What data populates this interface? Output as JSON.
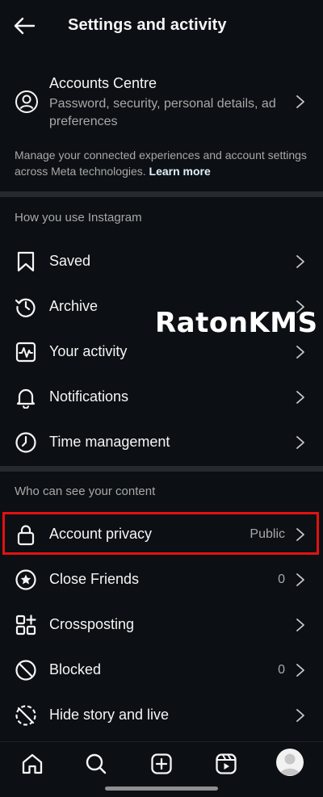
{
  "header": {
    "title": "Settings and activity"
  },
  "accounts_centre": {
    "title": "Accounts Centre",
    "description": "Password, security, personal details, ad preferences"
  },
  "meta_note": {
    "text": "Manage your connected experiences and account settings across Meta technologies.",
    "link": "Learn more"
  },
  "section_usage": {
    "header": "How you use Instagram",
    "items": [
      {
        "label": "Saved",
        "icon": "bookmark-icon"
      },
      {
        "label": "Archive",
        "icon": "archive-icon"
      },
      {
        "label": "Your activity",
        "icon": "activity-icon"
      },
      {
        "label": "Notifications",
        "icon": "bell-icon"
      },
      {
        "label": "Time management",
        "icon": "clock-icon"
      }
    ]
  },
  "section_content": {
    "header": "Who can see your content",
    "items": [
      {
        "label": "Account privacy",
        "value": "Public",
        "icon": "lock-icon",
        "highlighted": true
      },
      {
        "label": "Close Friends",
        "value": "0",
        "icon": "star-circle-icon"
      },
      {
        "label": "Crossposting",
        "value": "",
        "icon": "crossposting-icon"
      },
      {
        "label": "Blocked",
        "value": "0",
        "icon": "blocked-icon"
      },
      {
        "label": "Hide story and live",
        "value": "",
        "icon": "hide-story-icon"
      }
    ]
  },
  "watermark": "RatonKMS",
  "bottom_nav": [
    "home-icon",
    "search-icon",
    "new-post-icon",
    "reels-icon",
    "profile-avatar"
  ],
  "colors": {
    "background": "#0c1014",
    "highlight": "#e31111",
    "secondary_text": "#a8a8a8",
    "link": "#e0f1ff"
  }
}
